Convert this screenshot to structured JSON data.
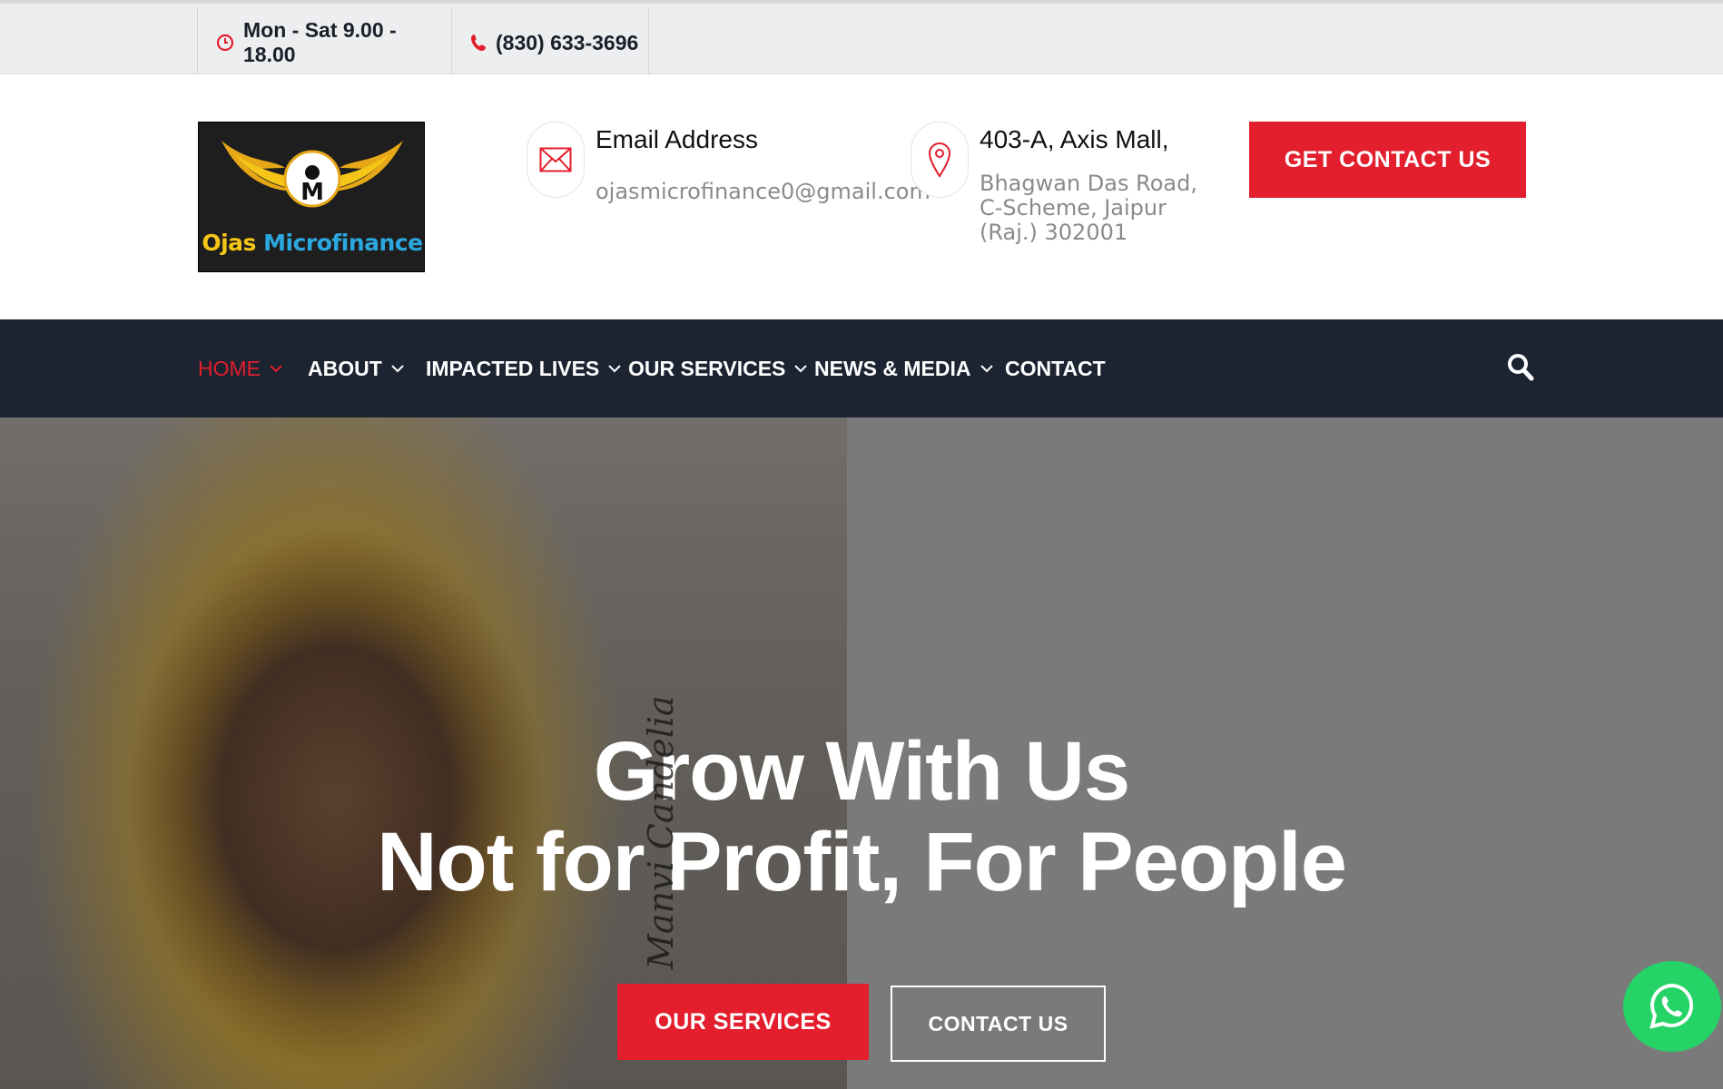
{
  "topbar": {
    "hours": "Mon - Sat 9.00 - 18.00",
    "phone": "(830) 633-3696",
    "hours_icon": "clock-icon",
    "phone_icon": "phone-icon"
  },
  "header": {
    "logo": {
      "word1": "Ojas",
      "word2": "Microfinance",
      "monogram": "M"
    },
    "email": {
      "title": "Email Address",
      "value": "ojasmicrofinance0@gmail.com",
      "icon": "envelope-icon"
    },
    "address": {
      "title": "403-A, Axis Mall,",
      "line1": "Bhagwan Das Road,",
      "line2": "C-Scheme, Jaipur",
      "line3": "(Raj.) 302001",
      "icon": "map-pin-icon"
    },
    "cta_label": "GET CONTACT US"
  },
  "nav": {
    "items": [
      {
        "label": "HOME",
        "active": true,
        "has_dropdown": true
      },
      {
        "label": "ABOUT",
        "has_dropdown": true
      },
      {
        "label": "IMPACTED LIVES",
        "has_dropdown": true
      },
      {
        "label": "OUR SERVICES",
        "has_dropdown": true
      },
      {
        "label": "NEWS & MEDIA",
        "has_dropdown": true
      },
      {
        "label": "CONTACT",
        "has_dropdown": false
      }
    ],
    "search_icon": "search-icon"
  },
  "hero": {
    "heading_line1": "Grow With Us",
    "heading_line2": "Not for Profit, For People",
    "signature": "Manvi Candelia",
    "primary_button": "OUR SERVICES",
    "secondary_button": "CONTACT US"
  },
  "floating": {
    "whatsapp_icon": "whatsapp-icon"
  },
  "colors": {
    "accent": "#e31e2d",
    "nav_bg": "#1c2331",
    "whatsapp": "#25d366"
  }
}
